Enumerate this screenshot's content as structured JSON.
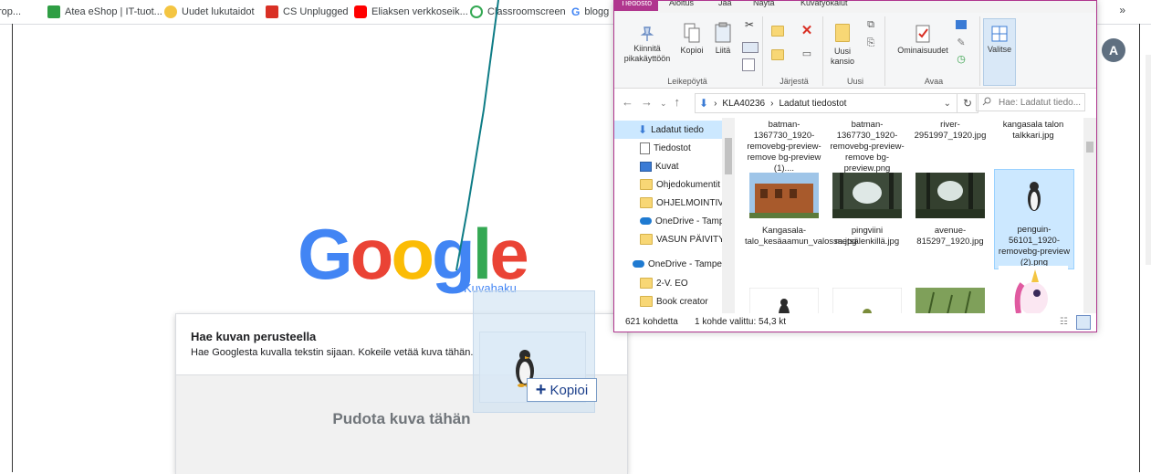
{
  "bookmarks": {
    "items": [
      {
        "label": "rop...",
        "icon": "bookmark-icon"
      },
      {
        "label": "Atea eShop | IT-tuot...",
        "icon": "atea-icon"
      },
      {
        "label": "Uudet lukutaidot",
        "icon": "bookmark-icon"
      },
      {
        "label": "CS Unplugged",
        "icon": "cs-icon"
      },
      {
        "label": "Eliaksen verkkoseik...",
        "icon": "youtube-icon"
      },
      {
        "label": "Classroomscreen",
        "icon": "classroomscreen-icon"
      },
      {
        "label": "blogg",
        "icon": "google-icon"
      }
    ],
    "more": "»"
  },
  "avatar": {
    "initial": "A"
  },
  "google": {
    "logo_letters": [
      "G",
      "o",
      "o",
      "g",
      "l",
      "e"
    ],
    "logo_colors": [
      "#4285f4",
      "#ea4335",
      "#fbbc05",
      "#4285f4",
      "#34a853",
      "#ea4335"
    ],
    "kuvahaku": "Kuvahaku"
  },
  "search_by_image": {
    "title": "Hae kuvan perusteella",
    "subtitle": "Hae Googlesta kuvalla tekstin sijaan. Kokeile vetää kuva tähän.",
    "drop_text": "Pudota kuva tähän"
  },
  "drag": {
    "badge_label": "Kopioi",
    "badge_symbol": "+"
  },
  "explorer": {
    "tabs": [
      "Tiedosto",
      "Aloitus",
      "Jaa",
      "Näytä",
      "Kuvatyökalut"
    ],
    "ribbon": {
      "pin_label": "Kiinnitä pikakäyttöön",
      "copy_label": "Kopioi",
      "paste_label": "Liitä",
      "clipboard_group": "Leikepöytä",
      "organize_group": "Järjestä",
      "new_folder_label": "Uusi kansio",
      "new_group": "Uusi",
      "properties_label": "Ominaisuudet",
      "open_group": "Avaa",
      "select_label": "Valitse"
    },
    "address": {
      "path": [
        "KLA40236",
        "Ladatut tiedostot"
      ],
      "search_placeholder": "Hae: Ladatut tiedo..."
    },
    "nav_items": [
      {
        "label": "Ladatut tiedo",
        "type": "download",
        "pinned": true,
        "selected": true
      },
      {
        "label": "Tiedostot",
        "type": "doc",
        "pinned": true
      },
      {
        "label": "Kuvat",
        "type": "pictures",
        "pinned": true
      },
      {
        "label": "Ohjedokumentit",
        "type": "folder"
      },
      {
        "label": "OHJELMOINTIVÄ",
        "type": "folder"
      },
      {
        "label": "OneDrive - Tamp",
        "type": "cloud"
      },
      {
        "label": "VASUN PÄIVITYS",
        "type": "folder"
      },
      {
        "label": "OneDrive - Tampe",
        "type": "cloud"
      },
      {
        "label": "2-V. EO",
        "type": "folder"
      },
      {
        "label": "Book creator",
        "type": "folder"
      }
    ],
    "files_row1": [
      {
        "name": "batman-1367730_1920-removebg-preview-remove bg-preview (1)...."
      },
      {
        "name": "batman-1367730_1920-removebg-preview-remove bg-preview.png"
      },
      {
        "name": "river-2951997_1920.jpg"
      },
      {
        "name": "kangasala talon talkkari.jpg"
      }
    ],
    "files_row2": [
      {
        "name": "Kangasala-talo_kesäaamun_valossa.jpg",
        "thumb": "building"
      },
      {
        "name": "pingviini metsälenkillä.jpg",
        "thumb": "forest"
      },
      {
        "name": "avenue-815297_1920.jpg",
        "thumb": "forest"
      },
      {
        "name": "penguin-56101_1920-removebg-preview (2).png",
        "thumb": "penguin",
        "selected": true
      }
    ],
    "status": {
      "count": "621 kohdetta",
      "selected": "1 kohde valittu: 54,3 kt"
    }
  }
}
